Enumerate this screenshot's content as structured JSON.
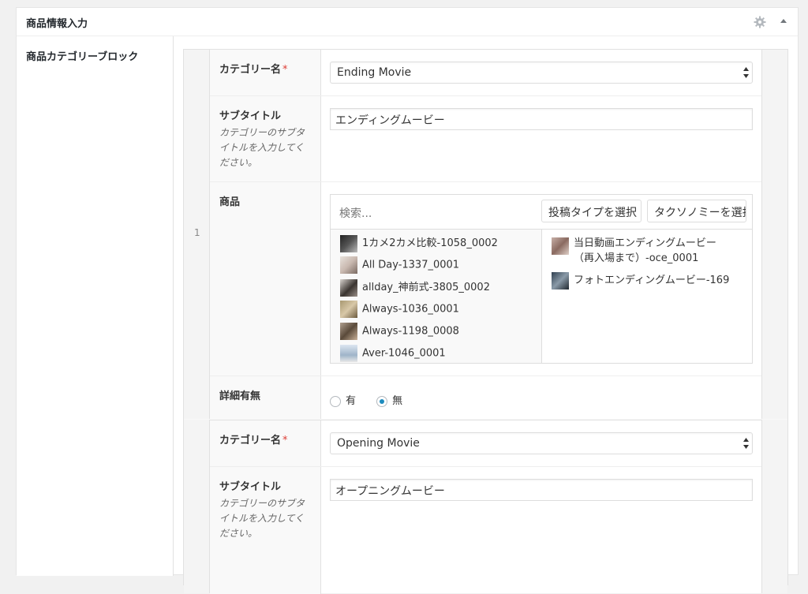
{
  "metabox": {
    "title": "商品情報入力",
    "gear_icon": "gear-icon",
    "toggle_icon": "triangle-up-icon"
  },
  "field": {
    "label": "商品カテゴリーブロック"
  },
  "rows": [
    {
      "number": "1",
      "category_label": "カテゴリー名",
      "required": "*",
      "category_value": "Ending Movie",
      "subtitle_label": "サブタイトル",
      "subtitle_desc": "カテゴリーのサブタイトルを入力してください。",
      "subtitle_value": "エンディングムービー",
      "products_label": "商品",
      "search_placeholder": "検索...",
      "post_type_select": "投稿タイプを選択",
      "taxonomy_select": "タクソノミーを選択",
      "choices": [
        "1カメ2カメ比較-1058_0002",
        "All Day-1337_0001",
        "allday_神前式-3805_0002",
        "Always-1036_0001",
        "Always-1198_0008",
        "Aver-1046_0001"
      ],
      "selected": [
        "当日動画エンディングムービー（再入場まで）-oce_0001",
        "フォトエンディングムービー-169"
      ],
      "detail_label": "詳細有無",
      "radio_yes": "有",
      "radio_no": "無"
    },
    {
      "category_label": "カテゴリー名",
      "required": "*",
      "category_value": "Opening Movie",
      "subtitle_label": "サブタイトル",
      "subtitle_desc": "カテゴリーのサブタイトルを入力してください。",
      "subtitle_value": "オープニングムービー"
    }
  ],
  "colors": {
    "required": "#dd3d36",
    "radio_selected": "#1e8cbe"
  }
}
